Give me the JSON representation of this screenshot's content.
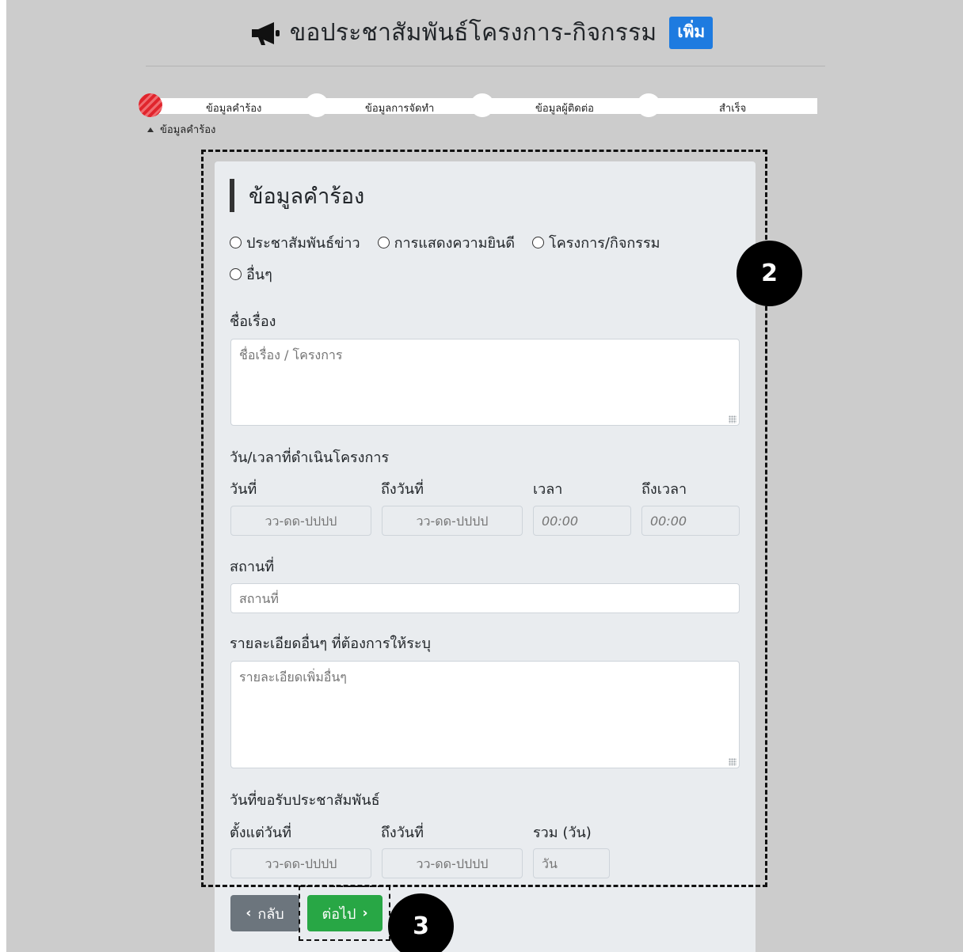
{
  "header": {
    "title": "ขอประชาสัมพันธ์โครงการ-กิจกรรม",
    "badge": "เพิ่ม",
    "icon": "megaphone-icon"
  },
  "stepper": {
    "steps": [
      {
        "label": "ข้อมูลคำร้อง",
        "active": true
      },
      {
        "label": "ข้อมูลการจัดทำ",
        "active": false
      },
      {
        "label": "ข้อมูลผู้ติดต่อ",
        "active": false
      },
      {
        "label": "สำเร็จ",
        "active": false
      }
    ],
    "current": "ข้อมูลคำร้อง"
  },
  "form": {
    "section_title": "ข้อมูลคำร้อง",
    "types": [
      "ประชาสัมพันธ์ข่าว",
      "การแสดงความยินดี",
      "โครงการ/กิจกรรม",
      "อื่นๆ"
    ],
    "subject": {
      "label": "ชื่อเรื่อง",
      "placeholder": "ชื่อเรื่อง / โครงการ"
    },
    "schedule": {
      "label": "วัน/เวลาที่ดำเนินโครงการ",
      "date_from_label": "วันที่",
      "date_to_label": "ถึงวันที่",
      "time_from_label": "เวลา",
      "time_to_label": "ถึงเวลา",
      "date_placeholder": "วว-ดด-ปปปป",
      "time_placeholder": "00:00"
    },
    "place": {
      "label": "สถานที่",
      "placeholder": "สถานที่"
    },
    "details": {
      "label": "รายละเอียดอื่นๆ ที่ต้องการให้ระบุ",
      "placeholder": "รายละเอียดเพิ่มอื่นๆ"
    },
    "pr_period": {
      "label": "วันที่ขอรับประชาสัมพันธ์",
      "from_label": "ตั้งแต่วันที่",
      "to_label": "ถึงวันที่",
      "total_label": "รวม (วัน)",
      "date_placeholder": "วว-ดด-ปปปป",
      "total_placeholder": "วัน"
    }
  },
  "buttons": {
    "back": "กลับ",
    "next": "ต่อไป"
  },
  "callouts": {
    "form_area": "2",
    "next_button": "3"
  },
  "colors": {
    "accent_blue": "#1e7be0",
    "success_green": "#28a745",
    "secondary_gray": "#6c757d",
    "step_active_red": "#e0242c"
  }
}
